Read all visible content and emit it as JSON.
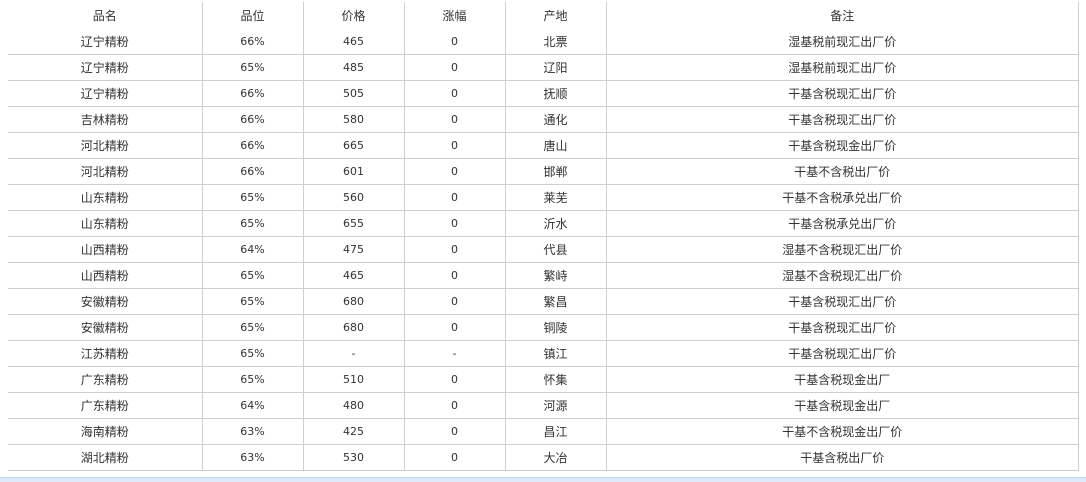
{
  "table": {
    "headers": [
      "品名",
      "品位",
      "价格",
      "涨幅",
      "产地",
      "备注"
    ],
    "rows": [
      [
        "辽宁精粉",
        "66%",
        "465",
        "0",
        "北票",
        "湿基税前现汇出厂价"
      ],
      [
        "辽宁精粉",
        "65%",
        "485",
        "0",
        "辽阳",
        "湿基税前现汇出厂价"
      ],
      [
        "辽宁精粉",
        "66%",
        "505",
        "0",
        "抚顺",
        "干基含税现汇出厂价"
      ],
      [
        "吉林精粉",
        "66%",
        "580",
        "0",
        "通化",
        "干基含税现汇出厂价"
      ],
      [
        "河北精粉",
        "66%",
        "665",
        "0",
        "唐山",
        "干基含税现金出厂价"
      ],
      [
        "河北精粉",
        "66%",
        "601",
        "0",
        "邯郸",
        "干基不含税出厂价"
      ],
      [
        "山东精粉",
        "65%",
        "560",
        "0",
        "莱芜",
        "干基不含税承兑出厂价"
      ],
      [
        "山东精粉",
        "65%",
        "655",
        "0",
        "沂水",
        "干基含税承兑出厂价"
      ],
      [
        "山西精粉",
        "64%",
        "475",
        "0",
        "代县",
        "湿基不含税现汇出厂价"
      ],
      [
        "山西精粉",
        "65%",
        "465",
        "0",
        "繁峙",
        "湿基不含税现汇出厂价"
      ],
      [
        "安徽精粉",
        "65%",
        "680",
        "0",
        "繁昌",
        "干基含税现汇出厂价"
      ],
      [
        "安徽精粉",
        "65%",
        "680",
        "0",
        "铜陵",
        "干基含税现汇出厂价"
      ],
      [
        "江苏精粉",
        "65%",
        "-",
        "-",
        "镇江",
        "干基含税现汇出厂价"
      ],
      [
        "广东精粉",
        "65%",
        "510",
        "0",
        "怀集",
        "干基含税现金出厂"
      ],
      [
        "广东精粉",
        "64%",
        "480",
        "0",
        "河源",
        "干基含税现金出厂"
      ],
      [
        "海南精粉",
        "63%",
        "425",
        "0",
        "昌江",
        "干基不含税现金出厂价"
      ],
      [
        "湖北精粉",
        "63%",
        "530",
        "0",
        "大冶",
        "干基含税出厂价"
      ]
    ]
  }
}
